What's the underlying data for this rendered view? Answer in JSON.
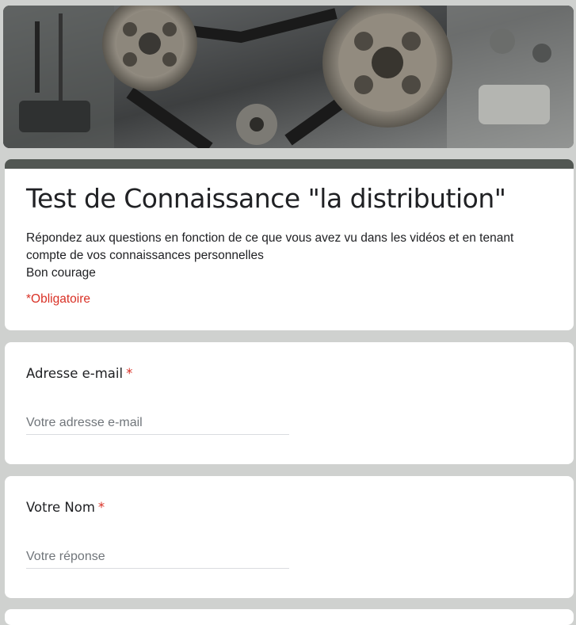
{
  "form": {
    "banner_icon": "engine-timing-belt-image",
    "title": "Test de Connaissance \"la distribution\"",
    "description_lines": [
      "Répondez aux questions en fonction de ce que vous avez vu dans les vidéos et en tenant compte de vos connaissances personnelles",
      "Bon courage"
    ],
    "required_note": "*Obligatoire",
    "accent_color": "#525753",
    "required_color": "#d93025"
  },
  "questions": [
    {
      "label": "Adresse e-mail",
      "required_mark": "*",
      "placeholder": "Votre adresse e-mail",
      "value": ""
    },
    {
      "label": "Votre Nom",
      "required_mark": "*",
      "placeholder": "Votre réponse",
      "value": ""
    }
  ]
}
